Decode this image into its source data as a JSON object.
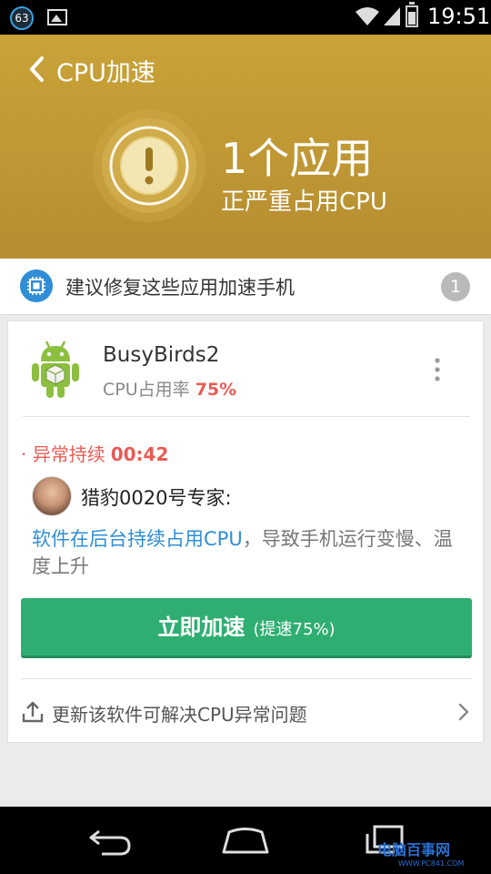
{
  "status_bar": {
    "notification_count": "63",
    "time": "19:51",
    "icons": [
      "notification-badge-icon",
      "image-icon",
      "wifi-icon",
      "signal-icon",
      "battery-icon"
    ]
  },
  "header": {
    "title": "CPU加速",
    "count_text": "1个应用",
    "subtitle": "正严重占用CPU",
    "warning_icon": "exclamation-icon",
    "bg_color": "#c29a35"
  },
  "section": {
    "text": "建议修复这些应用加速手机",
    "badge": "1",
    "icon": "cpu-chip-icon",
    "icon_color": "#2f8ed6"
  },
  "app_card": {
    "app_name": "BusyBirds2",
    "cpu_label": "CPU占用率",
    "cpu_percent": "75%",
    "icon": "android-app-icon",
    "abnormal_label": "异常持续",
    "abnormal_time": "00:42",
    "expert_name": "猎豹0020号专家:",
    "desc_highlight": "软件在后台持续占用CPU",
    "desc_rest": "，导致手机运行变慢、温度上升",
    "cta_label": "立即加速",
    "cta_sub": "(提速75%)",
    "cta_color": "#2fae71",
    "update_text": "更新该软件可解决CPU异常问题"
  },
  "nav_bar": {
    "icons": [
      "back-nav-icon",
      "home-nav-icon",
      "recent-apps-icon"
    ]
  },
  "watermark": {
    "text": "电脑百事网",
    "sub": "WWW.PC841.COM"
  }
}
